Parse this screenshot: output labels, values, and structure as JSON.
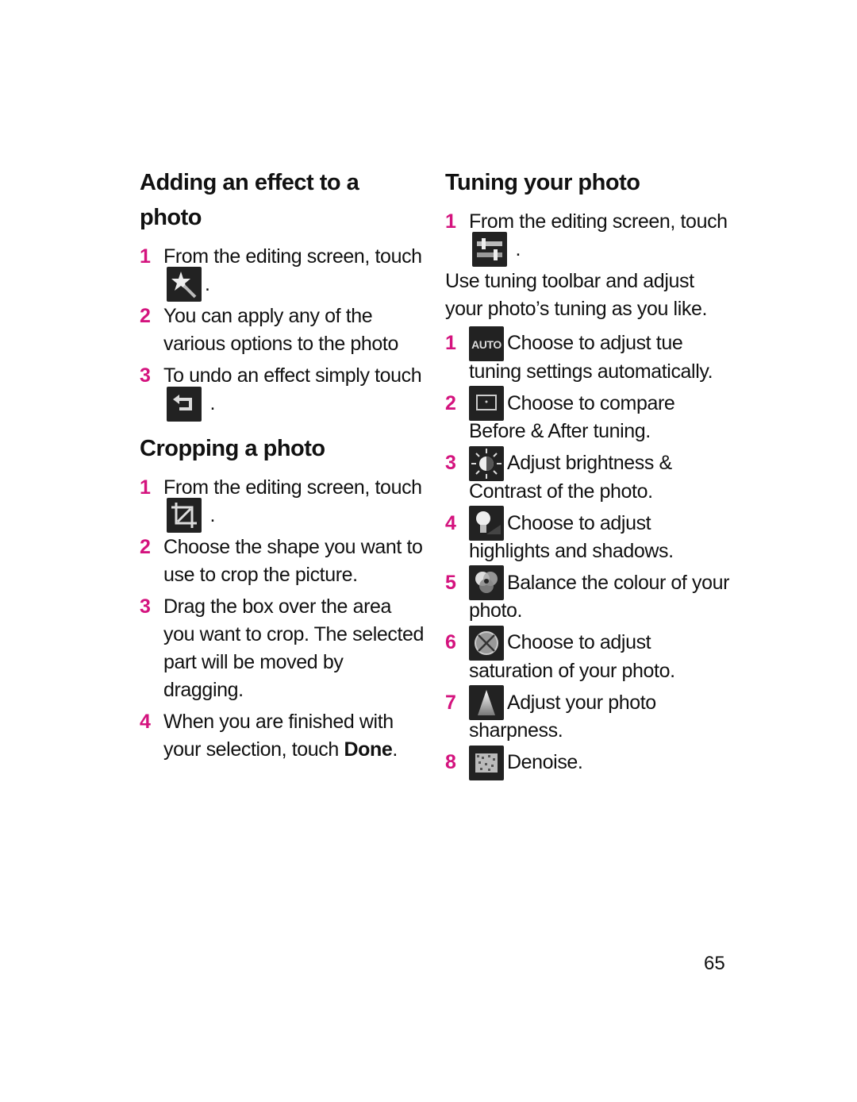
{
  "accent_color": "#d4137e",
  "left": {
    "effect": {
      "title": "Adding an effect to a photo",
      "steps": [
        {
          "num": "1",
          "text_before": "From the editing screen, touch",
          "icon": "magic-wand-icon",
          "text_after": "."
        },
        {
          "num": "2",
          "text": "You can apply any of the various options to the photo"
        },
        {
          "num": "3",
          "text_before": "To undo an effect simply touch",
          "icon": "undo-icon",
          "text_after": "."
        }
      ]
    },
    "crop": {
      "title": "Cropping a photo",
      "steps": [
        {
          "num": "1",
          "text_before": "From the editing screen, touch",
          "icon": "crop-icon",
          "text_after": "."
        },
        {
          "num": "2",
          "text": "Choose the shape you want to use to crop the picture."
        },
        {
          "num": "3",
          "text": "Drag the box over the area you want to crop. The selected part will be moved by dragging."
        },
        {
          "num": "4",
          "text_before": "When you are finished with your selection, touch",
          "bold": "Done",
          "text_after": "."
        }
      ]
    }
  },
  "right": {
    "tuning": {
      "title": "Tuning your photo",
      "step1": {
        "num": "1",
        "text_before": "From the editing screen, touch",
        "icon": "tuning-sliders-icon",
        "text_after": "."
      },
      "intro": "Use tuning toolbar and adjust your photo’s tuning as you like.",
      "items": [
        {
          "num": "1",
          "icon": "auto-icon",
          "icon_label": "AUTO",
          "text": "Choose to adjust tue tuning settings automatically."
        },
        {
          "num": "2",
          "icon": "compare-icon",
          "text": "Choose to compare Before & After tuning."
        },
        {
          "num": "3",
          "icon": "brightness-icon",
          "text": "Adjust brightness & Contrast of the photo."
        },
        {
          "num": "4",
          "icon": "highlight-bulb-icon",
          "text": "Choose to adjust highlights and shadows."
        },
        {
          "num": "5",
          "icon": "colour-balance-icon",
          "text": "Balance the colour of your photo."
        },
        {
          "num": "6",
          "icon": "saturation-icon",
          "text": "Choose to adjust saturation of your photo."
        },
        {
          "num": "7",
          "icon": "sharpness-icon",
          "text": "Adjust your photo sharpness."
        },
        {
          "num": "8",
          "icon": "denoise-icon",
          "text": "Denoise."
        }
      ]
    }
  },
  "page_number": "65"
}
